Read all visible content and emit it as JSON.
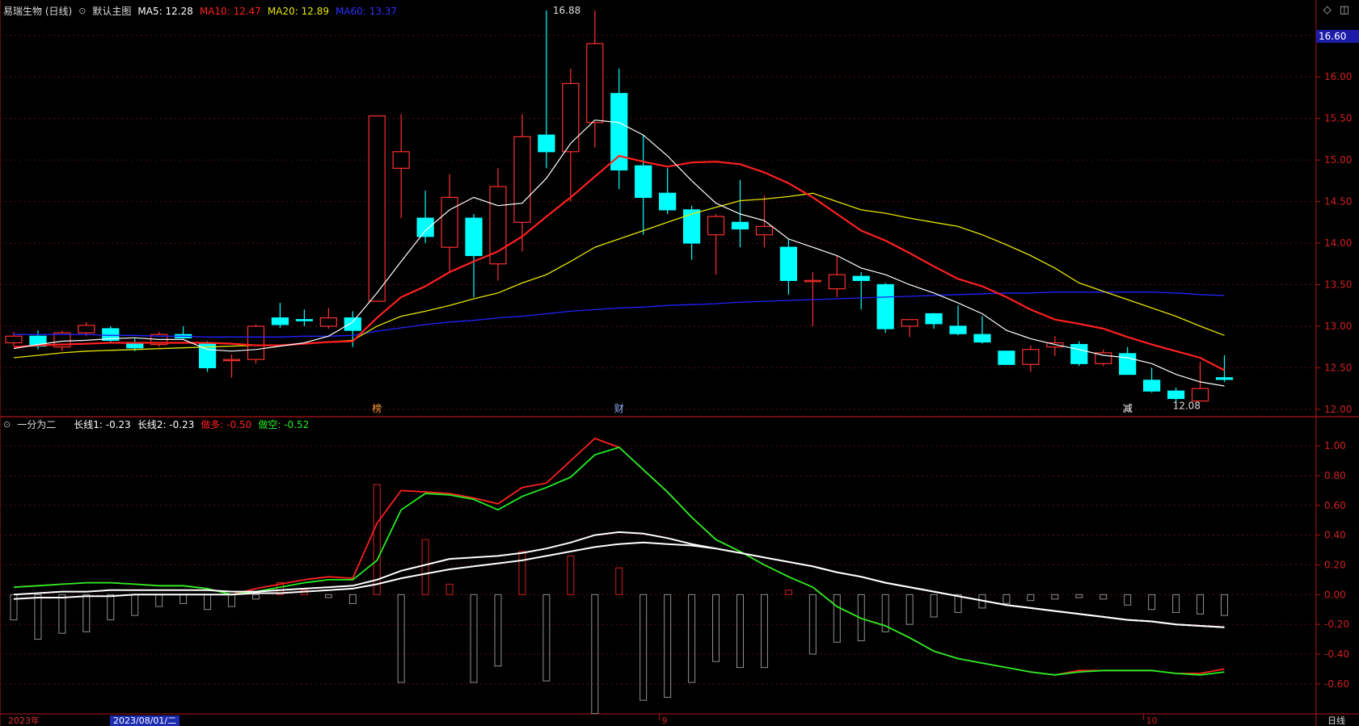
{
  "main": {
    "title": "易瑞生物 (日线)",
    "template": "默认主图",
    "ma5": {
      "label": "MA5:",
      "value": "12.28",
      "color": "#ffffff"
    },
    "ma10": {
      "label": "MA10:",
      "value": "12.47",
      "color": "#ff2020"
    },
    "ma20": {
      "label": "MA20:",
      "value": "12.89",
      "color": "#e5e500"
    },
    "ma60": {
      "label": "MA60:",
      "value": "13.37",
      "color": "#2222ff"
    },
    "current_price": "16.60",
    "high_label": "16.88",
    "low_label": "12.08",
    "events": [
      {
        "label": "榜",
        "index": 15,
        "color": "#ff9a33"
      },
      {
        "label": "财",
        "index": 25,
        "color": "#8fb0ff"
      },
      {
        "label": "减",
        "index": 46,
        "color": "#ffffff"
      }
    ]
  },
  "sub": {
    "name": "一分为二",
    "long1": {
      "label": "长线1:",
      "value": "-0.23",
      "color": "#ffffff"
    },
    "long2": {
      "label": "长线2:",
      "value": "-0.23",
      "color": "#ffffff"
    },
    "bull": {
      "label": "做多:",
      "value": "-0.50",
      "color": "#ff2020"
    },
    "bear": {
      "label": "做空:",
      "value": "-0.52",
      "color": "#22ee22"
    }
  },
  "footer": {
    "year": "2023年",
    "date": "2023/08/01/二",
    "month_labels": [
      {
        "label": "9",
        "index": 27
      },
      {
        "label": "10",
        "index": 47
      }
    ],
    "period": "日线"
  },
  "icons": {
    "diamond": "diamond-icon",
    "window": "window-icon"
  },
  "chart_data": [
    {
      "type": "candlestick",
      "ylim": [
        11.95,
        16.75
      ],
      "yticks": [
        "12.00",
        "12.50",
        "13.00",
        "13.50",
        "14.00",
        "14.50",
        "15.00",
        "15.50",
        "16.00",
        "16.50"
      ],
      "ohlc": [
        [
          12.8,
          12.93,
          12.76,
          12.88
        ],
        [
          12.88,
          12.95,
          12.72,
          12.76
        ],
        [
          12.75,
          12.95,
          12.7,
          12.92
        ],
        [
          12.92,
          13.05,
          12.88,
          13.01
        ],
        [
          12.97,
          13.0,
          12.8,
          12.83
        ],
        [
          12.8,
          12.85,
          12.7,
          12.74
        ],
        [
          12.78,
          12.93,
          12.75,
          12.9
        ],
        [
          12.9,
          13.0,
          12.85,
          12.86
        ],
        [
          12.8,
          12.82,
          12.45,
          12.5
        ],
        [
          12.6,
          12.66,
          12.38,
          12.6
        ],
        [
          12.6,
          13.02,
          12.55,
          13.0
        ],
        [
          13.1,
          13.28,
          12.98,
          13.02
        ],
        [
          13.08,
          13.2,
          13.0,
          13.07
        ],
        [
          13.0,
          13.22,
          12.97,
          13.1
        ],
        [
          13.1,
          13.18,
          12.75,
          12.95
        ],
        [
          13.3,
          15.53,
          13.3,
          15.53
        ],
        [
          14.9,
          15.55,
          14.3,
          15.1
        ],
        [
          14.3,
          14.63,
          14.0,
          14.08
        ],
        [
          13.95,
          14.83,
          13.65,
          14.55
        ],
        [
          14.3,
          14.35,
          13.35,
          13.85
        ],
        [
          13.75,
          14.9,
          13.55,
          14.68
        ],
        [
          14.25,
          15.55,
          13.9,
          15.28
        ],
        [
          15.3,
          16.8,
          14.9,
          15.1
        ],
        [
          15.1,
          16.1,
          14.5,
          15.92
        ],
        [
          15.45,
          16.8,
          15.15,
          16.4
        ],
        [
          15.8,
          16.1,
          14.65,
          14.88
        ],
        [
          14.93,
          15.3,
          14.1,
          14.55
        ],
        [
          14.6,
          14.9,
          14.35,
          14.4
        ],
        [
          14.4,
          14.45,
          13.8,
          14.0
        ],
        [
          14.1,
          14.35,
          13.62,
          14.32
        ],
        [
          14.25,
          14.76,
          13.95,
          14.17
        ],
        [
          14.1,
          14.57,
          13.95,
          14.2
        ],
        [
          13.95,
          14.05,
          13.38,
          13.55
        ],
        [
          13.55,
          13.65,
          13.0,
          13.55
        ],
        [
          13.45,
          13.85,
          13.35,
          13.62
        ],
        [
          13.6,
          13.65,
          13.2,
          13.55
        ],
        [
          13.5,
          13.52,
          12.92,
          12.97
        ],
        [
          13.0,
          13.08,
          12.87,
          13.08
        ],
        [
          13.15,
          13.16,
          12.97,
          13.03
        ],
        [
          13.0,
          13.25,
          12.89,
          12.91
        ],
        [
          12.9,
          13.12,
          12.79,
          12.81
        ],
        [
          12.7,
          12.7,
          12.54,
          12.54
        ],
        [
          12.54,
          12.77,
          12.45,
          12.72
        ],
        [
          12.75,
          12.88,
          12.64,
          12.8
        ],
        [
          12.78,
          12.82,
          12.52,
          12.55
        ],
        [
          12.55,
          12.72,
          12.52,
          12.68
        ],
        [
          12.67,
          12.75,
          12.42,
          12.42
        ],
        [
          12.35,
          12.5,
          12.2,
          12.22
        ],
        [
          12.22,
          12.26,
          12.08,
          12.13
        ],
        [
          12.1,
          12.57,
          12.1,
          12.25
        ],
        [
          12.38,
          12.65,
          12.33,
          12.36
        ]
      ],
      "ma5": [
        12.73,
        12.78,
        12.82,
        12.83,
        12.85,
        12.86,
        12.84,
        12.84,
        12.72,
        12.7,
        12.72,
        12.76,
        12.8,
        12.88,
        13.05,
        13.4,
        13.78,
        14.15,
        14.4,
        14.55,
        14.45,
        14.48,
        14.78,
        15.2,
        15.48,
        15.45,
        15.3,
        15.05,
        14.75,
        14.48,
        14.35,
        14.27,
        14.05,
        13.95,
        13.85,
        13.7,
        13.62,
        13.5,
        13.4,
        13.28,
        13.15,
        12.95,
        12.85,
        12.78,
        12.72,
        12.65,
        12.62,
        12.55,
        12.42,
        12.33,
        12.28
      ],
      "ma10": [
        12.75,
        12.77,
        12.78,
        12.79,
        12.8,
        12.8,
        12.8,
        12.8,
        12.8,
        12.79,
        12.77,
        12.77,
        12.79,
        12.81,
        12.82,
        13.1,
        13.35,
        13.48,
        13.65,
        13.78,
        13.9,
        14.08,
        14.32,
        14.55,
        14.8,
        15.05,
        14.98,
        14.92,
        14.97,
        14.98,
        14.95,
        14.85,
        14.72,
        14.55,
        14.35,
        14.15,
        14.03,
        13.88,
        13.72,
        13.57,
        13.48,
        13.35,
        13.2,
        13.08,
        13.03,
        12.97,
        12.87,
        12.78,
        12.7,
        12.62,
        12.47
      ],
      "ma20": [
        12.62,
        12.65,
        12.68,
        12.7,
        12.71,
        12.72,
        12.73,
        12.74,
        12.75,
        12.76,
        12.77,
        12.77,
        12.79,
        12.81,
        12.83,
        13.0,
        13.12,
        13.18,
        13.25,
        13.33,
        13.4,
        13.52,
        13.62,
        13.78,
        13.95,
        14.05,
        14.15,
        14.25,
        14.35,
        14.43,
        14.51,
        14.53,
        14.56,
        14.6,
        14.5,
        14.4,
        14.36,
        14.3,
        14.25,
        14.2,
        14.1,
        13.98,
        13.85,
        13.7,
        13.52,
        13.42,
        13.32,
        13.22,
        13.12,
        13.0,
        12.89
      ],
      "ma60": [
        12.9,
        12.9,
        12.9,
        12.9,
        12.89,
        12.89,
        12.88,
        12.88,
        12.87,
        12.87,
        12.87,
        12.87,
        12.88,
        12.88,
        12.89,
        12.94,
        12.98,
        13.02,
        13.05,
        13.07,
        13.1,
        13.12,
        13.15,
        13.18,
        13.2,
        13.22,
        13.23,
        13.25,
        13.26,
        13.27,
        13.29,
        13.3,
        13.31,
        13.32,
        13.33,
        13.34,
        13.35,
        13.36,
        13.37,
        13.38,
        13.39,
        13.4,
        13.4,
        13.41,
        13.41,
        13.41,
        13.41,
        13.41,
        13.4,
        13.38,
        13.37
      ]
    },
    {
      "type": "line",
      "ylim": [
        -0.78,
        1.12
      ],
      "yticks": [
        "1.00",
        "0.80",
        "0.60",
        "0.40",
        "0.20",
        "0.00",
        "-0.20",
        "-0.40",
        "-0.60"
      ],
      "series": [
        {
          "name": "做多",
          "color": "#ff2020",
          "values": [
            0.05,
            0.06,
            0.07,
            0.08,
            0.08,
            0.07,
            0.06,
            0.06,
            0.04,
            0.0,
            0.04,
            0.07,
            0.1,
            0.12,
            0.11,
            0.48,
            0.7,
            0.69,
            0.68,
            0.65,
            0.61,
            0.72,
            0.75,
            0.9,
            1.05,
            0.99,
            0.84,
            0.69,
            0.52,
            0.37,
            0.29,
            0.2,
            0.12,
            0.05,
            -0.08,
            -0.16,
            -0.21,
            -0.29,
            -0.38,
            -0.43,
            -0.46,
            -0.49,
            -0.52,
            -0.54,
            -0.51,
            -0.51,
            -0.51,
            -0.51,
            -0.53,
            -0.53,
            -0.5
          ]
        },
        {
          "name": "做空",
          "color": "#22ee22",
          "values": [
            0.05,
            0.06,
            0.07,
            0.08,
            0.08,
            0.07,
            0.06,
            0.06,
            0.04,
            0.0,
            0.02,
            0.05,
            0.08,
            0.1,
            0.1,
            0.23,
            0.57,
            0.68,
            0.67,
            0.64,
            0.57,
            0.66,
            0.72,
            0.79,
            0.94,
            0.99,
            0.84,
            0.69,
            0.52,
            0.37,
            0.29,
            0.2,
            0.12,
            0.05,
            -0.08,
            -0.16,
            -0.21,
            -0.29,
            -0.38,
            -0.43,
            -0.46,
            -0.49,
            -0.52,
            -0.54,
            -0.52,
            -0.51,
            -0.51,
            -0.51,
            -0.53,
            -0.54,
            -0.52
          ]
        },
        {
          "name": "长线1",
          "color": "#ffffff",
          "values": [
            0.0,
            0.01,
            0.02,
            0.02,
            0.03,
            0.03,
            0.03,
            0.03,
            0.03,
            0.02,
            0.02,
            0.03,
            0.04,
            0.05,
            0.06,
            0.1,
            0.16,
            0.2,
            0.24,
            0.25,
            0.26,
            0.28,
            0.31,
            0.35,
            0.4,
            0.42,
            0.41,
            0.38,
            0.34,
            0.31,
            0.28,
            0.25,
            0.22,
            0.19,
            0.15,
            0.12,
            0.08,
            0.05,
            0.02,
            -0.01,
            -0.04,
            -0.07,
            -0.09,
            -0.11,
            -0.13,
            -0.15,
            -0.17,
            -0.18,
            -0.2,
            -0.21,
            -0.22
          ]
        },
        {
          "name": "长线2",
          "color": "#ffffff",
          "values": [
            -0.03,
            -0.02,
            -0.02,
            -0.01,
            -0.01,
            0.0,
            0.0,
            0.0,
            0.0,
            0.0,
            0.01,
            0.01,
            0.02,
            0.03,
            0.04,
            0.07,
            0.11,
            0.14,
            0.17,
            0.19,
            0.21,
            0.23,
            0.26,
            0.29,
            0.32,
            0.34,
            0.35,
            0.34,
            0.33,
            0.31,
            0.28,
            0.25,
            0.22,
            0.19,
            0.15,
            0.12,
            0.08,
            0.05,
            0.02,
            -0.01,
            -0.04,
            -0.07,
            -0.09,
            -0.11,
            -0.13,
            -0.15,
            -0.17,
            -0.18,
            -0.2,
            -0.21,
            -0.22
          ]
        }
      ],
      "bars": [
        -0.17,
        -0.3,
        -0.26,
        -0.25,
        -0.17,
        -0.14,
        -0.08,
        -0.06,
        -0.1,
        -0.08,
        -0.03,
        0.08,
        0.03,
        -0.02,
        -0.06,
        0.74,
        -0.59,
        0.37,
        0.07,
        -0.59,
        -0.48,
        0.29,
        -0.58,
        0.26,
        -0.8,
        0.18,
        -0.71,
        -0.69,
        -0.59,
        -0.45,
        -0.49,
        -0.49,
        0.03,
        -0.4,
        -0.32,
        -0.31,
        -0.25,
        -0.2,
        -0.15,
        -0.12,
        -0.09,
        -0.06,
        -0.04,
        -0.03,
        -0.02,
        -0.03,
        -0.07,
        -0.1,
        -0.12,
        -0.13,
        -0.14
      ]
    }
  ]
}
